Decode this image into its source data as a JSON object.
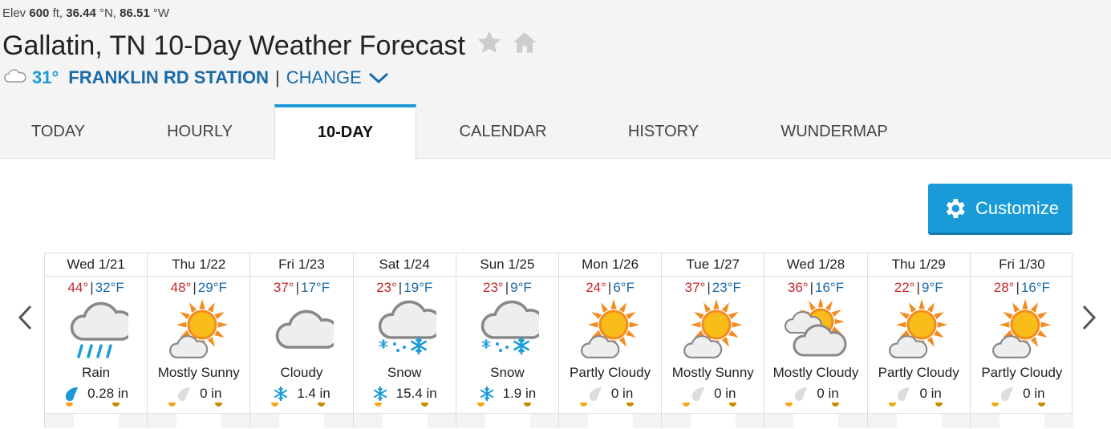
{
  "location": {
    "elev_label": "Elev",
    "elev_value": "600",
    "elev_unit": "ft,",
    "lat_value": "36.44",
    "lat_unit": "°N,",
    "lon_value": "86.51",
    "lon_unit": "°W",
    "title": "Gallatin, TN 10-Day Weather Forecast"
  },
  "station": {
    "temp": "31°",
    "name": "FRANKLIN RD STATION",
    "separator": "|",
    "change_label": "CHANGE"
  },
  "tabs": [
    {
      "label": "TODAY"
    },
    {
      "label": "HOURLY"
    },
    {
      "label": "10-DAY"
    },
    {
      "label": "CALENDAR"
    },
    {
      "label": "HISTORY"
    },
    {
      "label": "WUNDERMAP"
    }
  ],
  "customize_label": "Customize",
  "colors": {
    "accent": "#1a9bd7",
    "high": "#c8252c",
    "low": "#1a6aa8",
    "sun": "#f7a81b"
  },
  "days": [
    {
      "date": "Wed 1/21",
      "hi": "44°",
      "lo": "32°F",
      "icon": "rain-icon",
      "cond": "Rain",
      "precip_icon": "raindrop-icon",
      "precip": "0.28 in"
    },
    {
      "date": "Thu 1/22",
      "hi": "48°",
      "lo": "29°F",
      "icon": "mostly-sunny-icon",
      "cond": "Mostly Sunny",
      "precip_icon": "raindrop-gray-icon",
      "precip": "0 in"
    },
    {
      "date": "Fri 1/23",
      "hi": "37°",
      "lo": "17°F",
      "icon": "cloudy-icon",
      "cond": "Cloudy",
      "precip_icon": "snowflake-icon",
      "precip": "1.4 in"
    },
    {
      "date": "Sat 1/24",
      "hi": "23°",
      "lo": "19°F",
      "icon": "snow-icon",
      "cond": "Snow",
      "precip_icon": "snowflake-icon",
      "precip": "15.4 in"
    },
    {
      "date": "Sun 1/25",
      "hi": "23°",
      "lo": "9°F",
      "icon": "snow-icon",
      "cond": "Snow",
      "precip_icon": "snowflake-icon",
      "precip": "1.9 in"
    },
    {
      "date": "Mon 1/26",
      "hi": "24°",
      "lo": "6°F",
      "icon": "partly-cloudy-icon",
      "cond": "Partly Cloudy",
      "precip_icon": "raindrop-gray-icon",
      "precip": "0 in"
    },
    {
      "date": "Tue 1/27",
      "hi": "37°",
      "lo": "23°F",
      "icon": "mostly-sunny-icon",
      "cond": "Mostly Sunny",
      "precip_icon": "raindrop-gray-icon",
      "precip": "0 in"
    },
    {
      "date": "Wed 1/28",
      "hi": "36°",
      "lo": "16°F",
      "icon": "mostly-cloudy-icon",
      "cond": "Mostly Cloudy",
      "precip_icon": "raindrop-gray-icon",
      "precip": "0 in"
    },
    {
      "date": "Thu 1/29",
      "hi": "22°",
      "lo": "9°F",
      "icon": "partly-cloudy-icon",
      "cond": "Partly Cloudy",
      "precip_icon": "raindrop-gray-icon",
      "precip": "0 in"
    },
    {
      "date": "Fri 1/30",
      "hi": "28°",
      "lo": "16°F",
      "icon": "partly-cloudy-icon",
      "cond": "Partly Cloudy",
      "precip_icon": "raindrop-gray-icon",
      "precip": "0 in"
    }
  ]
}
